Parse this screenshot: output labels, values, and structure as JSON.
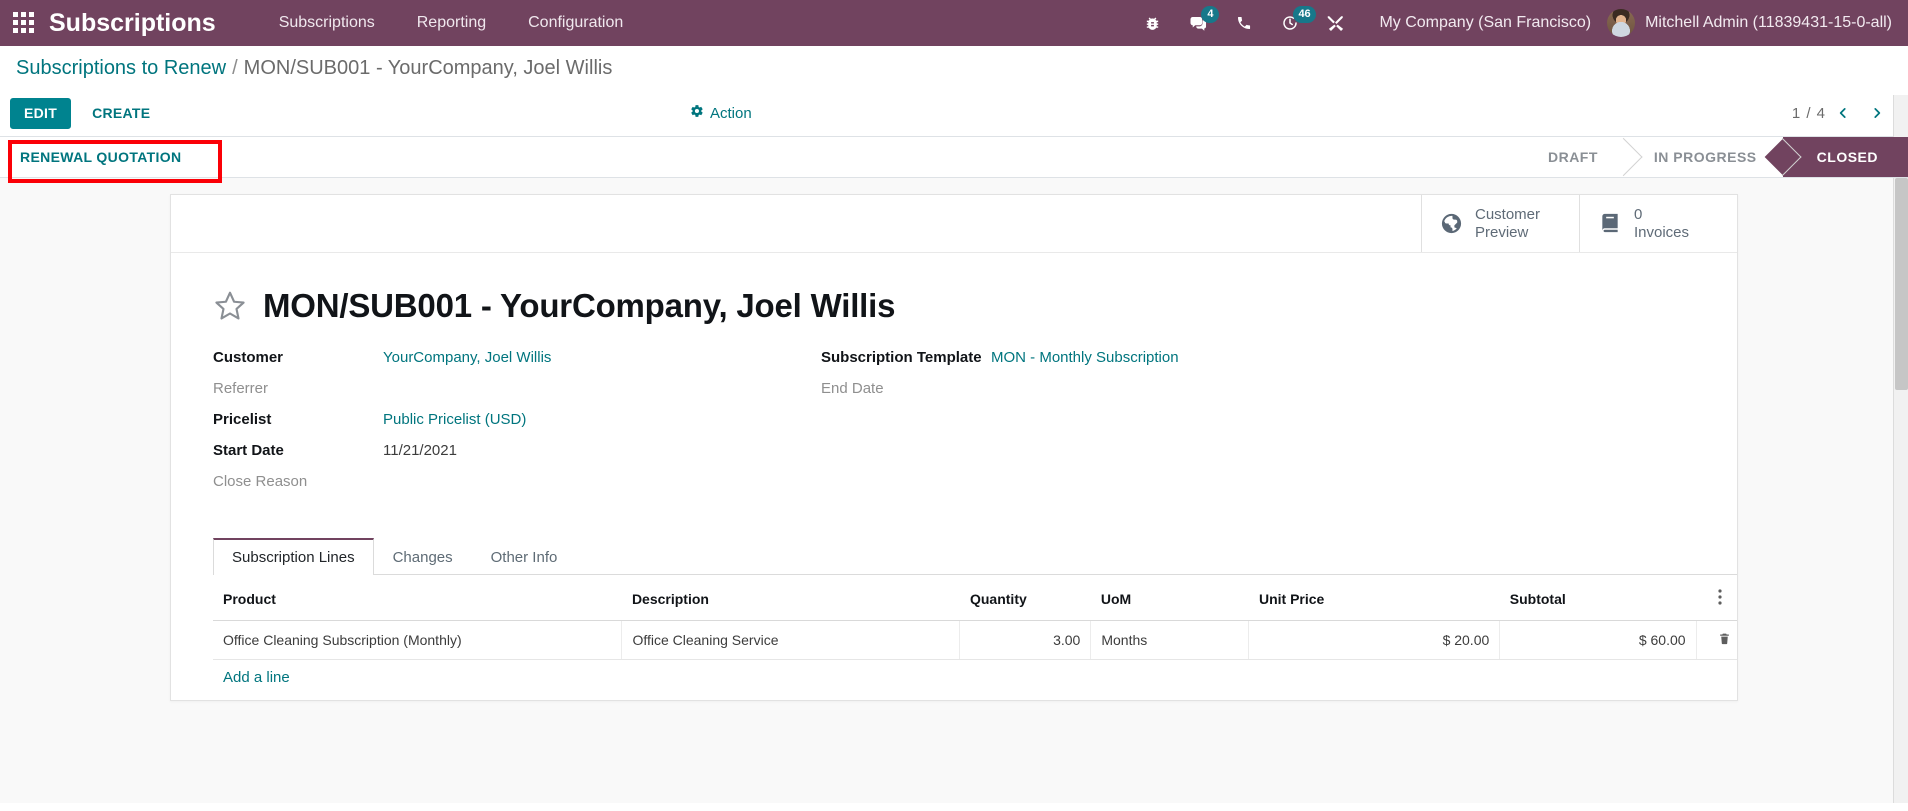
{
  "navbar": {
    "apps_icon": "apps-grid-icon",
    "brand": "Subscriptions",
    "menu": [
      {
        "label": "Subscriptions"
      },
      {
        "label": "Reporting"
      },
      {
        "label": "Configuration"
      }
    ],
    "icons": [
      {
        "name": "bug-icon",
        "badge": null
      },
      {
        "name": "messages-icon",
        "badge": "4"
      },
      {
        "name": "phone-icon",
        "badge": null
      },
      {
        "name": "activities-clock-icon",
        "badge": "46"
      },
      {
        "name": "tools-icon",
        "badge": null
      }
    ],
    "company": "My Company (San Francisco)",
    "user": "Mitchell Admin (11839431-15-0-all)",
    "bg_color": "#71435f"
  },
  "breadcrumb": {
    "parent": "Subscriptions to Renew",
    "separator": "/",
    "current": "MON/SUB001 - YourCompany, Joel Willis"
  },
  "control_panel": {
    "edit_label": "EDIT",
    "create_label": "CREATE",
    "action_label": "Action",
    "action_icon": "gear-icon",
    "pager_text": "1 / 4",
    "prev_icon": "chevron-left-icon",
    "next_icon": "chevron-right-icon"
  },
  "statusbar": {
    "renewal_button": "RENEWAL QUOTATION",
    "highlight_color": "#fb0007",
    "stages": [
      {
        "label": "DRAFT",
        "active": false
      },
      {
        "label": "IN PROGRESS",
        "active": false
      },
      {
        "label": "CLOSED",
        "active": true
      }
    ],
    "active_color": "#71435f"
  },
  "smart_buttons": [
    {
      "icon": "globe-icon",
      "line1": "Customer",
      "line2": "Preview"
    },
    {
      "icon": "invoice-book-icon",
      "line1": "0",
      "line2": "Invoices"
    }
  ],
  "record": {
    "star_icon": "star-outline-icon",
    "title": "MON/SUB001 - YourCompany, Joel Willis"
  },
  "form": {
    "left": [
      {
        "label": "Customer",
        "value": "YourCompany, Joel Willis",
        "link": true,
        "filled": true
      },
      {
        "label": "Referrer",
        "value": "",
        "link": false,
        "filled": false
      },
      {
        "label": "Pricelist",
        "value": "Public Pricelist (USD)",
        "link": true,
        "filled": true
      },
      {
        "label": "Start Date",
        "value": "11/21/2021",
        "link": false,
        "filled": true
      },
      {
        "label": "Close Reason",
        "value": "",
        "link": false,
        "filled": false
      }
    ],
    "right": [
      {
        "label": "Subscription Template",
        "value": "MON - Monthly Subscription",
        "link": true,
        "filled": true
      },
      {
        "label": "End Date",
        "value": "",
        "link": false,
        "filled": false
      }
    ]
  },
  "notebook": {
    "tabs": [
      {
        "label": "Subscription Lines",
        "active": true
      },
      {
        "label": "Changes",
        "active": false
      },
      {
        "label": "Other Info",
        "active": false
      }
    ]
  },
  "lines": {
    "columns": [
      "Product",
      "Description",
      "Quantity",
      "UoM",
      "Unit Price",
      "Subtotal"
    ],
    "options_icon": "column-options-icon",
    "rows": [
      {
        "product": "Office Cleaning Subscription (Monthly)",
        "description": "Office Cleaning Service",
        "quantity": "3.00",
        "uom": "Months",
        "unit_price": "$ 20.00",
        "subtotal": "$ 60.00",
        "delete_icon": "trash-icon"
      }
    ],
    "add_line_label": "Add a line"
  }
}
